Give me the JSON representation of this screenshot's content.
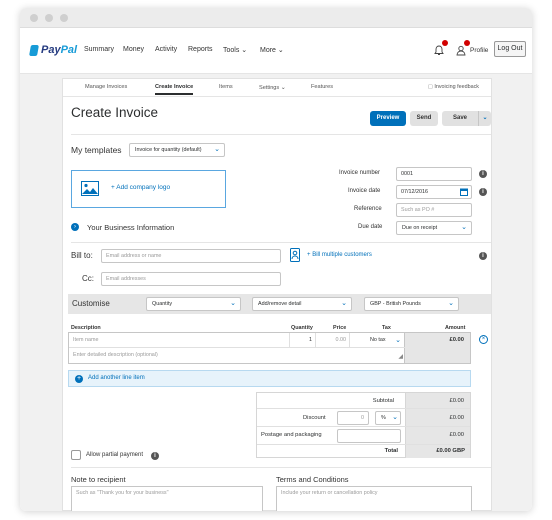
{
  "nav": {
    "logo_pay": "Pay",
    "logo_pal": "Pal",
    "items": [
      "Summary",
      "Money",
      "Activity",
      "Reports",
      "Tools",
      "Money",
      "More"
    ],
    "summary": "Summary",
    "money": "Money",
    "activity": "Activity",
    "reports": "Reports",
    "tools": "Tools",
    "more": "More",
    "profile": "Profile",
    "logout": "Log Out"
  },
  "tabs": {
    "manage": "Manage Invoices",
    "create": "Create Invoice",
    "items": "Items",
    "settings": "Settings",
    "features": "Features",
    "feedback": "Invoicing feedback"
  },
  "header": {
    "title": "Create Invoice",
    "preview": "Preview",
    "send": "Send",
    "save": "Save"
  },
  "templates": {
    "label": "My templates",
    "value": "Invoice for quantity (default)"
  },
  "logo_box": {
    "label": "Add company logo"
  },
  "business": {
    "label": "Your Business Information"
  },
  "meta": {
    "invoice_number_label": "Invoice number",
    "invoice_number": "0001",
    "invoice_date_label": "Invoice date",
    "invoice_date": "07/12/2016",
    "reference_label": "Reference",
    "reference_placeholder": "Such as PO #",
    "due_date_label": "Due date",
    "due_date": "Due on receipt"
  },
  "billing": {
    "bill_to_label": "Bill to:",
    "bill_to_placeholder": "Email address or name",
    "bill_multiple": "Bill multiple customers",
    "cc_label": "Cc:",
    "cc_placeholder": "Email addresses"
  },
  "customise": {
    "label": "Customise",
    "quantity": "Quantity",
    "detail": "Add/remove detail",
    "currency": "GBP - British Pounds"
  },
  "items_table": {
    "headers": {
      "description": "Description",
      "quantity": "Quantity",
      "price": "Price",
      "tax": "Tax",
      "amount": "Amount"
    },
    "name_placeholder": "Item name",
    "qty": "1",
    "price": "0.00",
    "tax": "No tax",
    "amount": "£0.00",
    "desc_placeholder": "Enter detailed description (optional)",
    "add_line": "Add another line item"
  },
  "totals": {
    "subtotal_label": "Subtotal",
    "subtotal": "£0.00",
    "discount_label": "Discount",
    "discount_value": "0",
    "discount_unit": "%",
    "discount": "£0.00",
    "postage_label": "Postage and packaging",
    "postage": "£0.00",
    "total_label": "Total",
    "total": "£0.00 GBP"
  },
  "partial": {
    "label": "Allow partial payment"
  },
  "notes": {
    "note_label": "Note to recipient",
    "note_placeholder": "Such as \"Thank you for your business\"",
    "terms_label": "Terms and Conditions",
    "terms_placeholder": "Include your return or cancellation policy"
  },
  "colors": {
    "primary": "#0070ba",
    "brand_dark": "#253b80",
    "brand_light": "#179bd7"
  }
}
